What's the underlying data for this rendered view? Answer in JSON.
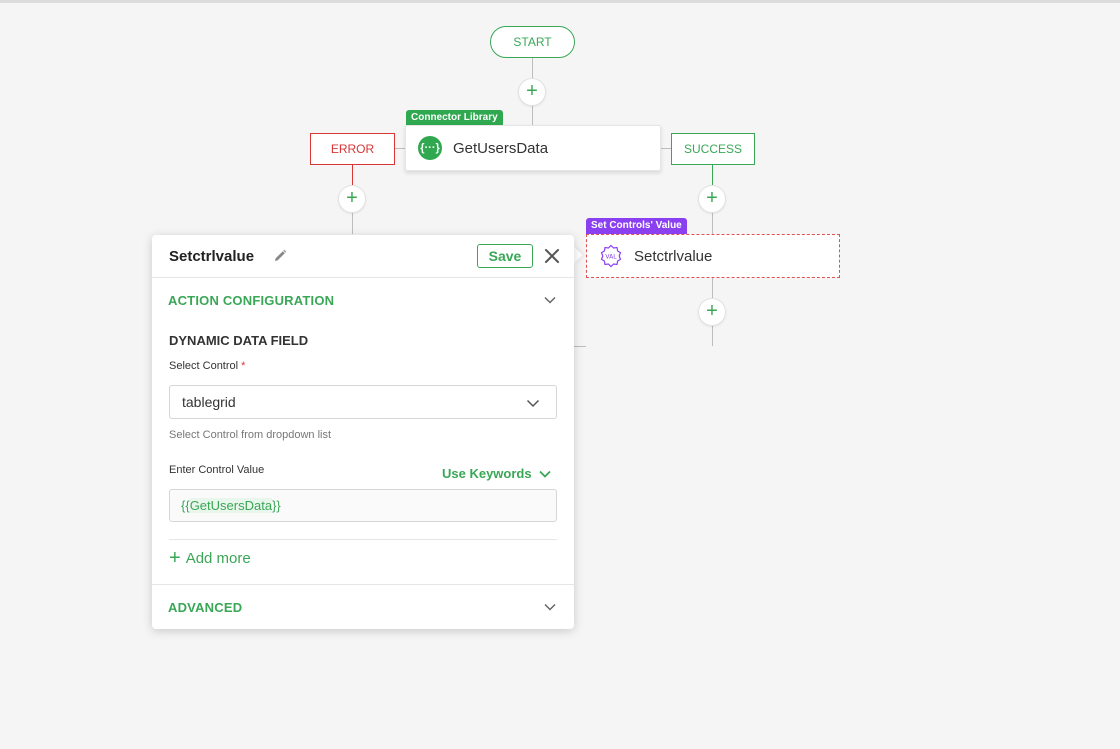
{
  "flow": {
    "start_label": "START",
    "add_symbol": "+",
    "connector_node": {
      "tag": "Connector Library",
      "label": "GetUsersData",
      "icon": "api-braces-icon",
      "icon_text": "{···}"
    },
    "error_label": "ERROR",
    "success_label": "SUCCESS",
    "setctrl_node": {
      "tag": "Set Controls' Value",
      "label": "Setctrlvalue",
      "icon": "val-badge-icon",
      "icon_text": "VAL"
    }
  },
  "panel": {
    "title": "Setctrlvalue",
    "save_label": "Save",
    "action_config_title": "ACTION CONFIGURATION",
    "dynamic_data_field": "DYNAMIC DATA FIELD",
    "select_control_label": "Select Control",
    "required_mark": "*",
    "select_control_value": "tablegrid",
    "select_control_hint": "Select Control from dropdown list",
    "enter_value_label": "Enter Control Value",
    "use_keywords_label": "Use Keywords",
    "value": {
      "open": "{{",
      "keyword": "GetUsersData",
      "close": "}}"
    },
    "add_more_label": "Add more",
    "advanced_title": "ADVANCED"
  },
  "colors": {
    "accent_green": "#3aa757",
    "error_red": "#d93636",
    "tag_purple": "#8a3ff0",
    "canvas_bg": "#f5f5f5"
  }
}
